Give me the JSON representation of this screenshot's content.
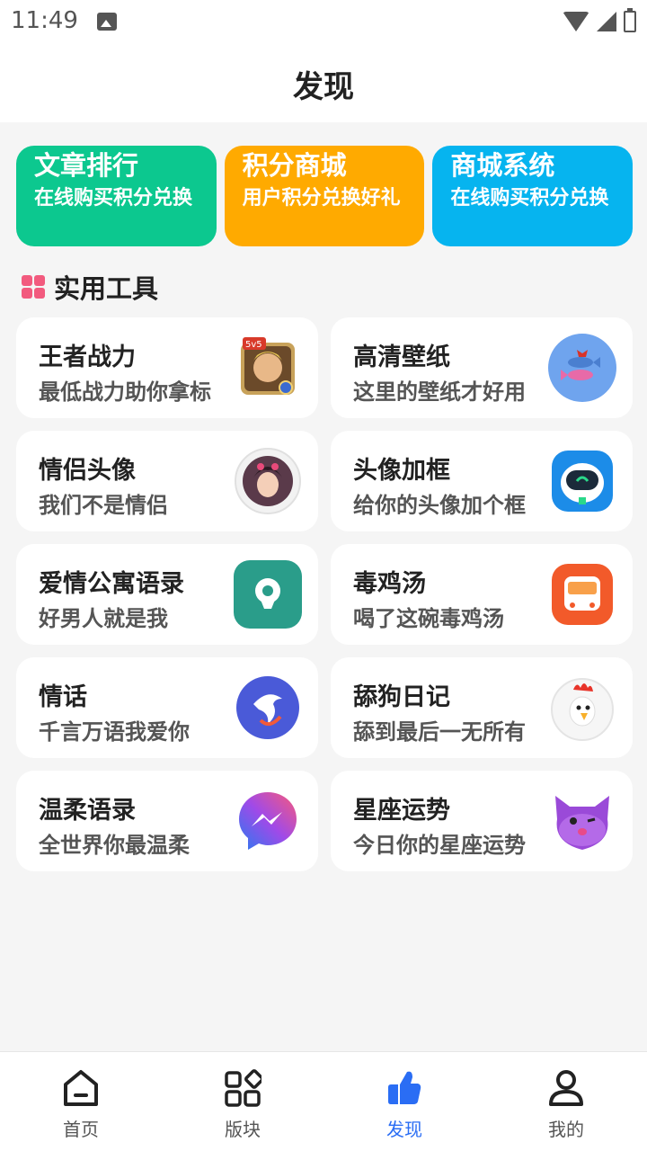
{
  "status": {
    "time": "11:49"
  },
  "header": {
    "title": "发现"
  },
  "features": [
    {
      "title": "文章排行",
      "subtitle": "在线购买积分兑换",
      "color": "#0cc88f"
    },
    {
      "title": "积分商城",
      "subtitle": "用户积分兑换好礼",
      "color": "#ffaa00"
    },
    {
      "title": "商城系统",
      "subtitle": "在线购买积分兑换",
      "color": "#06b4ef"
    }
  ],
  "section": {
    "title": "实用工具"
  },
  "tools": [
    {
      "name": "王者战力",
      "desc": "最低战力助你拿标",
      "icon": "game-hero-icon"
    },
    {
      "name": "高清壁纸",
      "desc": "这里的壁纸才好用",
      "icon": "fish-wallpaper-icon"
    },
    {
      "name": "情侣头像",
      "desc": "我们不是情侣",
      "icon": "girl-avatar-icon"
    },
    {
      "name": "头像加框",
      "desc": "给你的头像加个框",
      "icon": "robot-frame-icon"
    },
    {
      "name": "爱情公寓语录",
      "desc": "好男人就是我",
      "icon": "chat-bubble-icon"
    },
    {
      "name": "毒鸡汤",
      "desc": "喝了这碗毒鸡汤",
      "icon": "bus-icon"
    },
    {
      "name": "情话",
      "desc": "千言万语我爱你",
      "icon": "dolphin-icon"
    },
    {
      "name": "舔狗日记",
      "desc": "舔到最后一无所有",
      "icon": "rooster-icon"
    },
    {
      "name": "温柔语录",
      "desc": "全世界你最温柔",
      "icon": "messenger-icon"
    },
    {
      "name": "星座运势",
      "desc": "今日你的星座运势",
      "icon": "purple-cat-icon"
    }
  ],
  "nav": {
    "items": [
      {
        "label": "首页",
        "icon": "home-icon"
      },
      {
        "label": "版块",
        "icon": "blocks-icon"
      },
      {
        "label": "发现",
        "icon": "discover-icon",
        "active": true
      },
      {
        "label": "我的",
        "icon": "profile-icon"
      }
    ],
    "active_color": "#2a6df4"
  }
}
